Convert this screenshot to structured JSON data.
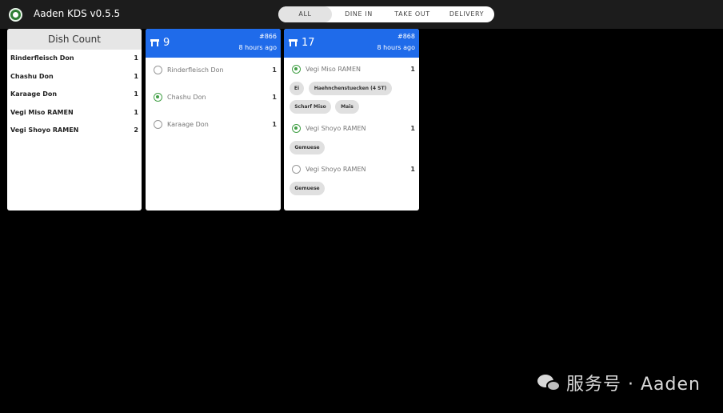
{
  "app": {
    "title": "Aaden KDS v0.5.5"
  },
  "filter": {
    "all": "ALL",
    "dine_in": "DINE IN",
    "take_out": "TAKE OUT",
    "delivery": "DELIVERY"
  },
  "dish_count": {
    "title": "Dish Count",
    "rows": [
      {
        "name": "Rinderfleisch Don",
        "count": "1"
      },
      {
        "name": "Chashu Don",
        "count": "1"
      },
      {
        "name": "Karaage Don",
        "count": "1"
      },
      {
        "name": "Vegi Miso RAMEN",
        "count": "1"
      },
      {
        "name": "Vegi Shoyo RAMEN",
        "count": "2"
      }
    ]
  },
  "orders": [
    {
      "table": "9",
      "order_no": "#866",
      "time": "8 hours ago",
      "items": [
        {
          "name": "Rinderfleisch Don",
          "qty": "1",
          "done": false
        },
        {
          "name": "Chashu Don",
          "qty": "1",
          "done": true
        },
        {
          "name": "Karaage Don",
          "qty": "1",
          "done": false
        }
      ]
    },
    {
      "table": "17",
      "order_no": "#868",
      "time": "8 hours ago",
      "items": [
        {
          "name": "Vegi Miso RAMEN",
          "qty": "1",
          "done": true,
          "mods": [
            "Ei",
            "Haehnchenstuecken (4 ST)",
            "Scharf Miso",
            "Mais"
          ]
        },
        {
          "name": "Vegi Shoyo RAMEN",
          "qty": "1",
          "done": true,
          "mods": [
            "Gemuese"
          ]
        },
        {
          "name": "Vegi Shoyo RAMEN",
          "qty": "1",
          "done": false,
          "mods": [
            "Gemuese"
          ]
        }
      ]
    }
  ],
  "watermark": "服务号 · Aaden",
  "colors": {
    "order_header": "#1f6bea",
    "done_green": "#43a047",
    "background": "#000000"
  }
}
